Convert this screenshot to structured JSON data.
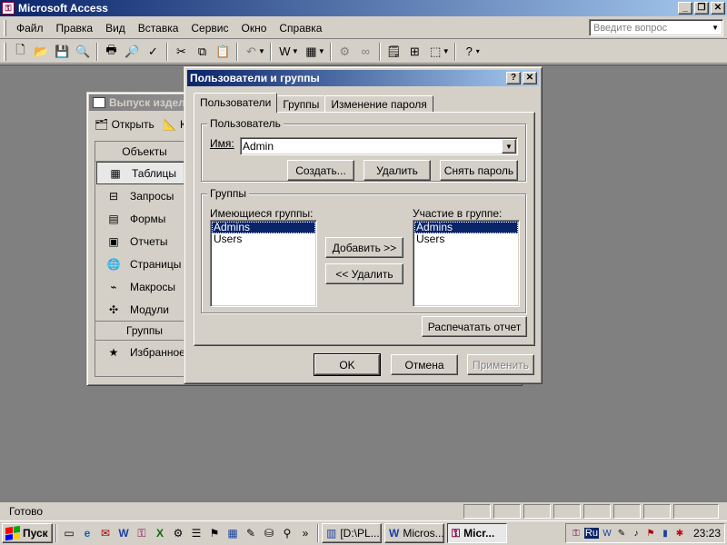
{
  "app": {
    "title": "Microsoft Access",
    "window_buttons": [
      "_",
      "❐",
      "✕"
    ]
  },
  "menu": {
    "items": [
      "Файл",
      "Правка",
      "Вид",
      "Вставка",
      "Сервис",
      "Окно",
      "Справка"
    ],
    "ask_placeholder": "Введите вопрос"
  },
  "toolbar": {
    "icons": [
      "new-icon",
      "open-icon",
      "save-icon",
      "file-search-icon",
      "print-icon",
      "print-preview-icon",
      "spelling-icon",
      "cut-icon",
      "copy-icon",
      "paste-icon",
      "undo-icon",
      "office-links-icon",
      "analyze-icon",
      "code-icon",
      "script-icon",
      "properties-icon",
      "relationships-icon",
      "new-object-icon",
      "help-icon"
    ]
  },
  "db_window": {
    "title": "Выпуск издел",
    "open_label": "Открыть",
    "construct_label": "К",
    "objects_header": "Объекты",
    "objects": [
      {
        "label": "Таблицы",
        "icon": "table-icon"
      },
      {
        "label": "Запросы",
        "icon": "query-icon"
      },
      {
        "label": "Формы",
        "icon": "form-icon"
      },
      {
        "label": "Отчеты",
        "icon": "report-icon"
      },
      {
        "label": "Страницы",
        "icon": "page-icon"
      },
      {
        "label": "Макросы",
        "icon": "macro-icon"
      },
      {
        "label": "Модули",
        "icon": "module-icon"
      }
    ],
    "groups_header": "Группы",
    "favorites_label": "Избранное"
  },
  "dialog": {
    "title": "Пользователи и группы",
    "help_button": "?",
    "close_button": "✕",
    "tabs": [
      "Пользователи",
      "Группы",
      "Изменение пароля"
    ],
    "user_group_label": "Пользователь",
    "name_label": "Имя:",
    "name_value": "Admin",
    "create_button": "Создать...",
    "delete_button": "Удалить",
    "clear_password_button": "Снять пароль",
    "groups_group_label": "Группы",
    "available_label": "Имеющиеся группы:",
    "available_groups": [
      "Admins",
      "Users"
    ],
    "member_label": "Участие в группе:",
    "member_groups": [
      "Admins",
      "Users"
    ],
    "add_button": "Добавить >>",
    "remove_button": "<< Удалить",
    "print_report_button": "Распечатать отчет",
    "ok_button": "OK",
    "cancel_button": "Отмена",
    "apply_button": "Применить"
  },
  "status": {
    "text": "Готово"
  },
  "taskbar": {
    "start_label": "Пуск",
    "tasks": [
      "[D:\\PL...",
      "Micros...",
      "Micr..."
    ],
    "language": "Ru",
    "clock": "23:23",
    "more": "»"
  }
}
